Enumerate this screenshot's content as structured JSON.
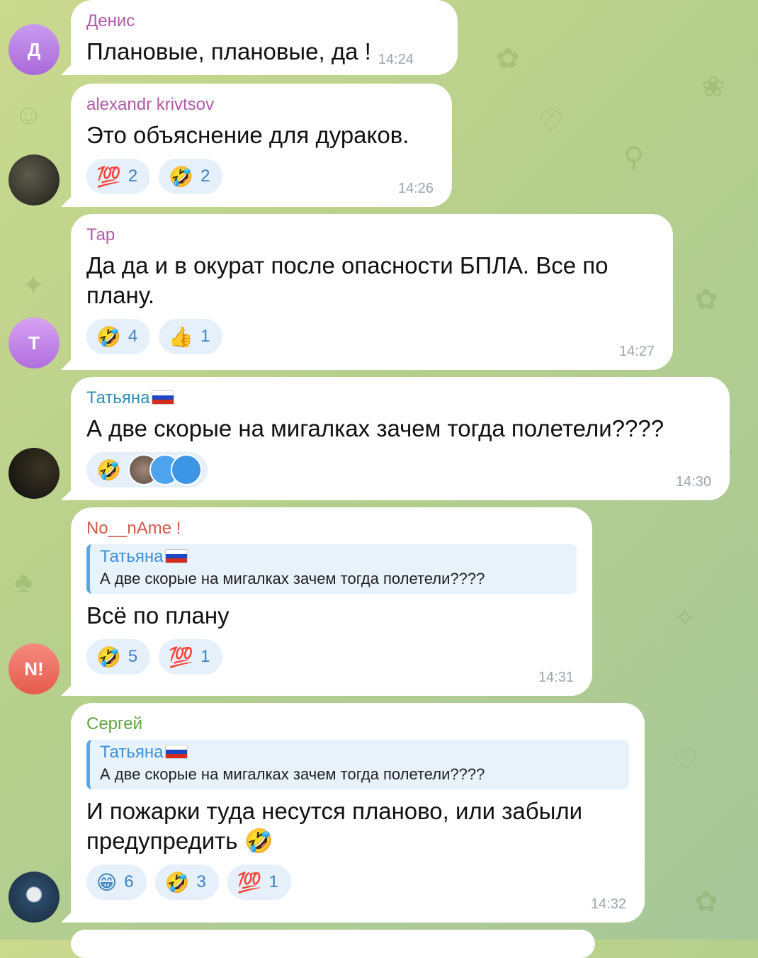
{
  "messages": [
    {
      "sender": "Денис",
      "sender_color": "#b25aa8",
      "text": "Плановые, плановые, да !",
      "time": "14:24",
      "avatar": "Д",
      "avatar_color": "#b97ee0"
    },
    {
      "sender": "alexandr krivtsov",
      "sender_color": "#b25aa8",
      "text": "Это объяснение для дураков.",
      "time": "14:26",
      "reactions": [
        {
          "emoji": "💯",
          "count": "2"
        },
        {
          "emoji": "🤣",
          "count": "2"
        }
      ]
    },
    {
      "sender": "Тар",
      "sender_color": "#b25aa8",
      "text": "Да да и в окурат после опасности БПЛА. Все по плану.",
      "time": "14:27",
      "avatar": "Т",
      "avatar_color": "#c07be6",
      "reactions": [
        {
          "emoji": "🤣",
          "count": "4"
        },
        {
          "emoji": "👍",
          "count": "1"
        }
      ]
    },
    {
      "sender": "Татьяна",
      "sender_color": "#2e8fb8",
      "text": "А две скорые на мигалках зачем тогда полетели????",
      "time": "14:30",
      "reactions": [
        {
          "emoji": "🤣",
          "count": ""
        }
      ]
    },
    {
      "sender": "No__nAme !",
      "sender_color": "#d45a4a",
      "text": "Всё по плану",
      "time": "14:31",
      "avatar": "N!",
      "avatar_color": "#ec6a5e",
      "reply": {
        "name": "Татьяна",
        "text": "А две скорые на мигалках зачем тогда полетели????"
      },
      "reactions": [
        {
          "emoji": "🤣",
          "count": "5"
        },
        {
          "emoji": "💯",
          "count": "1"
        }
      ]
    },
    {
      "sender": "Сергей",
      "sender_color": "#5fa540",
      "text": "И пожарки туда несутся планово, или забыли предупредить",
      "text_emoji": "🤣",
      "time": "14:32",
      "reply": {
        "name": "Татьяна",
        "text": "А две скорые на мигалках зачем тогда полетели????"
      },
      "reactions": [
        {
          "emoji": "😁",
          "count": "6"
        },
        {
          "emoji": "🤣",
          "count": "3"
        },
        {
          "emoji": "💯",
          "count": "1"
        }
      ]
    }
  ]
}
